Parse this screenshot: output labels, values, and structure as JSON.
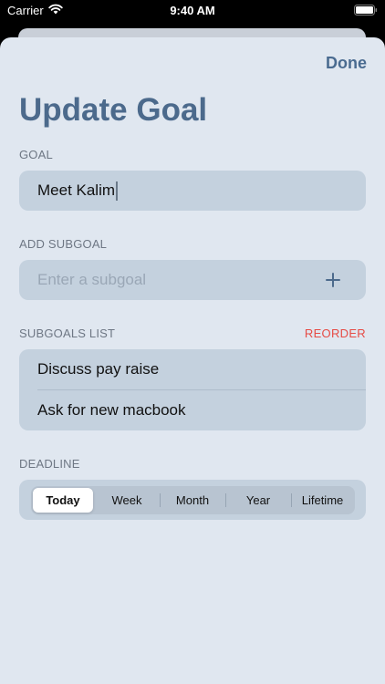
{
  "status_bar": {
    "carrier": "Carrier",
    "time": "9:40 AM"
  },
  "header": {
    "done_label": "Done",
    "title": "Update Goal"
  },
  "goal": {
    "label": "GOAL",
    "value": "Meet Kalim"
  },
  "add_subgoal": {
    "label": "ADD SUBGOAL",
    "placeholder": "Enter a subgoal"
  },
  "subgoals": {
    "label": "SUBGOALS LIST",
    "reorder_label": "REORDER",
    "items": [
      "Discuss pay raise",
      "Ask for new macbook"
    ]
  },
  "deadline": {
    "label": "DEADLINE",
    "options": [
      "Today",
      "Week",
      "Month",
      "Year",
      "Lifetime"
    ],
    "selected": "Today"
  },
  "colors": {
    "accent": "#4c6a8c",
    "reorder": "#e64b45",
    "sheet_background": "#e0e7f0",
    "field_background": "#c4d1de"
  },
  "icons": {
    "wifi": "wifi-icon",
    "battery": "battery-icon",
    "add": "plus-icon"
  }
}
